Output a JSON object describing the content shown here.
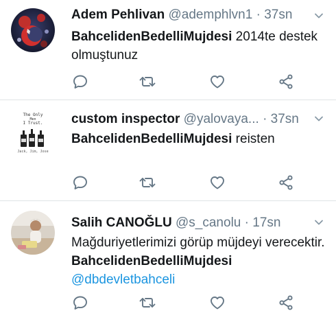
{
  "tweets": [
    {
      "name": "Adem Pehlivan",
      "handle": "@ademphlvn1",
      "dot": "·",
      "time": "37sn",
      "hashtag": "BahcelidenBedelliMujdesi",
      "text_after": " 2014te destek olmuştunuz"
    },
    {
      "name": "custom inspector",
      "handle": "@yalovaya...",
      "dot": "·",
      "time": "37sn",
      "hashtag": "BahcelidenBedelliMujdesi",
      "text_after": " reisten"
    },
    {
      "name": "Salih CANOĞLU",
      "handle": "@s_canolu",
      "dot": "·",
      "time": "17sn",
      "text_before": "Mağduriyetlerimizi görüp müjdeyi verecektir. ",
      "hashtag": "BahcelidenBedelliMujdesi",
      "mention": "@dbdevletbahceli"
    }
  ],
  "avatar2_text": {
    "line1": "The Only",
    "line2": "Men",
    "line3": "I Trust.",
    "line4": "Jack, Jim, Jose"
  },
  "icons": [
    "reply-icon",
    "retweet-icon",
    "like-icon",
    "share-icon",
    "chevron-down-icon"
  ],
  "colors": {
    "icon": "#657786",
    "mention": "#1b95e0",
    "divider": "#dfe3e6"
  }
}
